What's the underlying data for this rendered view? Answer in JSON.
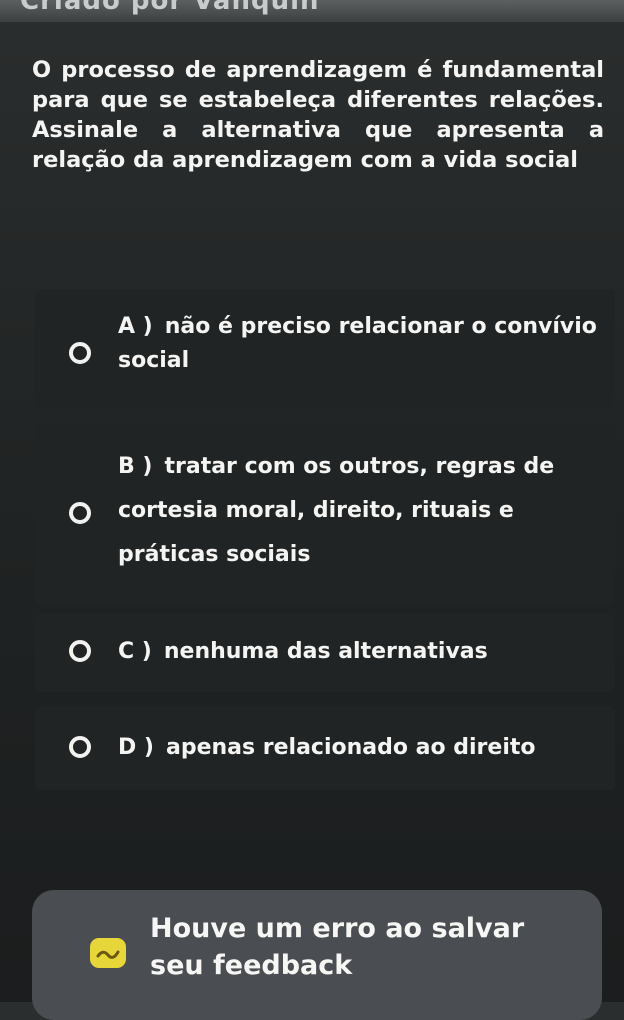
{
  "header": {
    "partial_text": "Criado por Vanquin"
  },
  "question": {
    "text": "O processo de aprendizagem é fundamental para que se estabeleça diferentes relações. Assinale a alternativa que apresenta a relação da aprendizagem com a vida social"
  },
  "options": [
    {
      "letter": "A )",
      "text": "não é preciso relacionar o convívio social",
      "selected": false
    },
    {
      "letter": "B )",
      "text": "tratar com os outros, regras de cortesia moral, direito, rituais e práticas sociais",
      "selected": false
    },
    {
      "letter": "C )",
      "text": "nenhuma das alternativas",
      "selected": false
    },
    {
      "letter": "D )",
      "text": "apenas relacionado ao direito",
      "selected": false
    }
  ],
  "toast": {
    "icon": "warning-face-icon",
    "message": "Houve um erro ao salvar seu feedback",
    "icon_color": "#e7d63a"
  },
  "colors": {
    "background": "#242727",
    "option_background": "#212424",
    "toast_background": "#4a4e52",
    "text": "#f4f4f2"
  }
}
